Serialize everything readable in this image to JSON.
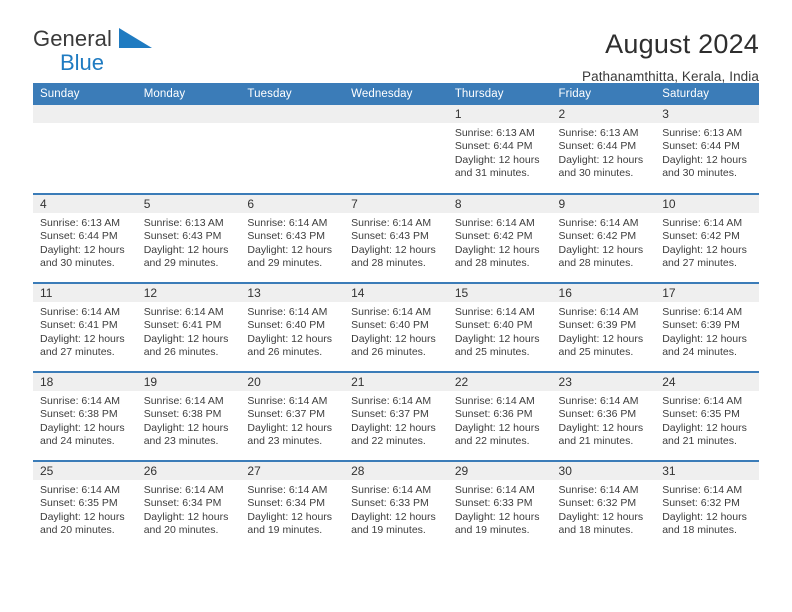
{
  "brand": {
    "name_top": "General",
    "name_bottom": "Blue",
    "flag_icon": "blue-triangle-flag-icon",
    "colors": {
      "text": "#3a3a3a",
      "blue": "#1f7bc1"
    }
  },
  "header": {
    "title": "August 2024",
    "subtitle": "Pathanamthitta, Kerala, India"
  },
  "theme": {
    "header_blue": "#3b7cb8",
    "daynum_band": "#efefef",
    "cell_background": "#ffffff"
  },
  "weekday_headers": [
    "Sunday",
    "Monday",
    "Tuesday",
    "Wednesday",
    "Thursday",
    "Friday",
    "Saturday"
  ],
  "labels": {
    "sunrise_prefix": "Sunrise:",
    "sunset_prefix": "Sunset:",
    "daylight_prefix": "Daylight:"
  },
  "weeks": [
    [
      {
        "day": "",
        "sunrise": "",
        "sunset": "",
        "daylight": "",
        "empty": true
      },
      {
        "day": "",
        "sunrise": "",
        "sunset": "",
        "daylight": "",
        "empty": true
      },
      {
        "day": "",
        "sunrise": "",
        "sunset": "",
        "daylight": "",
        "empty": true
      },
      {
        "day": "",
        "sunrise": "",
        "sunset": "",
        "daylight": "",
        "empty": true
      },
      {
        "day": "1",
        "sunrise": "Sunrise: 6:13 AM",
        "sunset": "Sunset: 6:44 PM",
        "daylight": "Daylight: 12 hours and 31 minutes."
      },
      {
        "day": "2",
        "sunrise": "Sunrise: 6:13 AM",
        "sunset": "Sunset: 6:44 PM",
        "daylight": "Daylight: 12 hours and 30 minutes."
      },
      {
        "day": "3",
        "sunrise": "Sunrise: 6:13 AM",
        "sunset": "Sunset: 6:44 PM",
        "daylight": "Daylight: 12 hours and 30 minutes."
      }
    ],
    [
      {
        "day": "4",
        "sunrise": "Sunrise: 6:13 AM",
        "sunset": "Sunset: 6:44 PM",
        "daylight": "Daylight: 12 hours and 30 minutes."
      },
      {
        "day": "5",
        "sunrise": "Sunrise: 6:13 AM",
        "sunset": "Sunset: 6:43 PM",
        "daylight": "Daylight: 12 hours and 29 minutes."
      },
      {
        "day": "6",
        "sunrise": "Sunrise: 6:14 AM",
        "sunset": "Sunset: 6:43 PM",
        "daylight": "Daylight: 12 hours and 29 minutes."
      },
      {
        "day": "7",
        "sunrise": "Sunrise: 6:14 AM",
        "sunset": "Sunset: 6:43 PM",
        "daylight": "Daylight: 12 hours and 28 minutes."
      },
      {
        "day": "8",
        "sunrise": "Sunrise: 6:14 AM",
        "sunset": "Sunset: 6:42 PM",
        "daylight": "Daylight: 12 hours and 28 minutes."
      },
      {
        "day": "9",
        "sunrise": "Sunrise: 6:14 AM",
        "sunset": "Sunset: 6:42 PM",
        "daylight": "Daylight: 12 hours and 28 minutes."
      },
      {
        "day": "10",
        "sunrise": "Sunrise: 6:14 AM",
        "sunset": "Sunset: 6:42 PM",
        "daylight": "Daylight: 12 hours and 27 minutes."
      }
    ],
    [
      {
        "day": "11",
        "sunrise": "Sunrise: 6:14 AM",
        "sunset": "Sunset: 6:41 PM",
        "daylight": "Daylight: 12 hours and 27 minutes."
      },
      {
        "day": "12",
        "sunrise": "Sunrise: 6:14 AM",
        "sunset": "Sunset: 6:41 PM",
        "daylight": "Daylight: 12 hours and 26 minutes."
      },
      {
        "day": "13",
        "sunrise": "Sunrise: 6:14 AM",
        "sunset": "Sunset: 6:40 PM",
        "daylight": "Daylight: 12 hours and 26 minutes."
      },
      {
        "day": "14",
        "sunrise": "Sunrise: 6:14 AM",
        "sunset": "Sunset: 6:40 PM",
        "daylight": "Daylight: 12 hours and 26 minutes."
      },
      {
        "day": "15",
        "sunrise": "Sunrise: 6:14 AM",
        "sunset": "Sunset: 6:40 PM",
        "daylight": "Daylight: 12 hours and 25 minutes."
      },
      {
        "day": "16",
        "sunrise": "Sunrise: 6:14 AM",
        "sunset": "Sunset: 6:39 PM",
        "daylight": "Daylight: 12 hours and 25 minutes."
      },
      {
        "day": "17",
        "sunrise": "Sunrise: 6:14 AM",
        "sunset": "Sunset: 6:39 PM",
        "daylight": "Daylight: 12 hours and 24 minutes."
      }
    ],
    [
      {
        "day": "18",
        "sunrise": "Sunrise: 6:14 AM",
        "sunset": "Sunset: 6:38 PM",
        "daylight": "Daylight: 12 hours and 24 minutes."
      },
      {
        "day": "19",
        "sunrise": "Sunrise: 6:14 AM",
        "sunset": "Sunset: 6:38 PM",
        "daylight": "Daylight: 12 hours and 23 minutes."
      },
      {
        "day": "20",
        "sunrise": "Sunrise: 6:14 AM",
        "sunset": "Sunset: 6:37 PM",
        "daylight": "Daylight: 12 hours and 23 minutes."
      },
      {
        "day": "21",
        "sunrise": "Sunrise: 6:14 AM",
        "sunset": "Sunset: 6:37 PM",
        "daylight": "Daylight: 12 hours and 22 minutes."
      },
      {
        "day": "22",
        "sunrise": "Sunrise: 6:14 AM",
        "sunset": "Sunset: 6:36 PM",
        "daylight": "Daylight: 12 hours and 22 minutes."
      },
      {
        "day": "23",
        "sunrise": "Sunrise: 6:14 AM",
        "sunset": "Sunset: 6:36 PM",
        "daylight": "Daylight: 12 hours and 21 minutes."
      },
      {
        "day": "24",
        "sunrise": "Sunrise: 6:14 AM",
        "sunset": "Sunset: 6:35 PM",
        "daylight": "Daylight: 12 hours and 21 minutes."
      }
    ],
    [
      {
        "day": "25",
        "sunrise": "Sunrise: 6:14 AM",
        "sunset": "Sunset: 6:35 PM",
        "daylight": "Daylight: 12 hours and 20 minutes."
      },
      {
        "day": "26",
        "sunrise": "Sunrise: 6:14 AM",
        "sunset": "Sunset: 6:34 PM",
        "daylight": "Daylight: 12 hours and 20 minutes."
      },
      {
        "day": "27",
        "sunrise": "Sunrise: 6:14 AM",
        "sunset": "Sunset: 6:34 PM",
        "daylight": "Daylight: 12 hours and 19 minutes."
      },
      {
        "day": "28",
        "sunrise": "Sunrise: 6:14 AM",
        "sunset": "Sunset: 6:33 PM",
        "daylight": "Daylight: 12 hours and 19 minutes."
      },
      {
        "day": "29",
        "sunrise": "Sunrise: 6:14 AM",
        "sunset": "Sunset: 6:33 PM",
        "daylight": "Daylight: 12 hours and 19 minutes."
      },
      {
        "day": "30",
        "sunrise": "Sunrise: 6:14 AM",
        "sunset": "Sunset: 6:32 PM",
        "daylight": "Daylight: 12 hours and 18 minutes."
      },
      {
        "day": "31",
        "sunrise": "Sunrise: 6:14 AM",
        "sunset": "Sunset: 6:32 PM",
        "daylight": "Daylight: 12 hours and 18 minutes."
      }
    ]
  ]
}
